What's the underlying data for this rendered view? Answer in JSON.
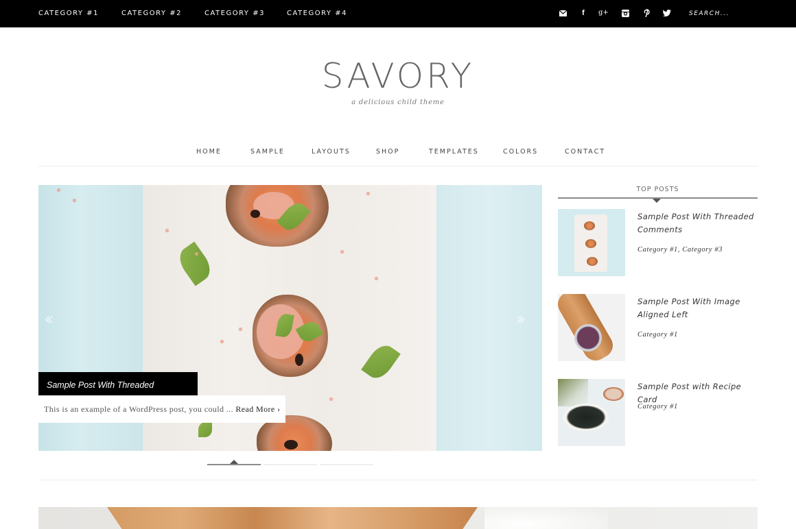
{
  "topbar": {
    "categories": [
      "CATEGORY #1",
      "CATEGORY #2",
      "CATEGORY #3",
      "CATEGORY #4"
    ],
    "social_icons": [
      "email-icon",
      "facebook-icon",
      "google-plus-icon",
      "instagram-icon",
      "pinterest-icon",
      "twitter-icon"
    ],
    "social_glyphs": [
      "✉",
      "f",
      "g+",
      "◙",
      "℗",
      "🐦"
    ],
    "search_placeholder": "SEARCH..."
  },
  "site": {
    "title": "SAVORY",
    "tagline": "a delicious child theme"
  },
  "nav": {
    "items": [
      "HOME",
      "SAMPLE",
      "LAYOUTS",
      "SHOP",
      "TEMPLATES",
      "COLORS",
      "CONTACT"
    ]
  },
  "slider": {
    "prev_glyph": "‹‹",
    "next_glyph": "››",
    "slide_title": "Sample Post With Threaded Comments",
    "excerpt": "This is an example of a WordPress post, you could ... ",
    "read_more": "Read More ›",
    "slide_count": 3,
    "active_slide": 1
  },
  "sidebar": {
    "widget_title": "TOP POSTS",
    "posts": [
      {
        "title": "Sample Post With Threaded Comments",
        "categories": "Category #1, Category #3"
      },
      {
        "title": "Sample Post With Image Aligned Left",
        "categories": "Category #1"
      },
      {
        "title": "Sample Post with Recipe Card",
        "categories": "Category #1"
      }
    ]
  },
  "colors": {
    "topbar_bg": "#000000",
    "accent_line": "#8a8a8a",
    "text": "#333333"
  }
}
